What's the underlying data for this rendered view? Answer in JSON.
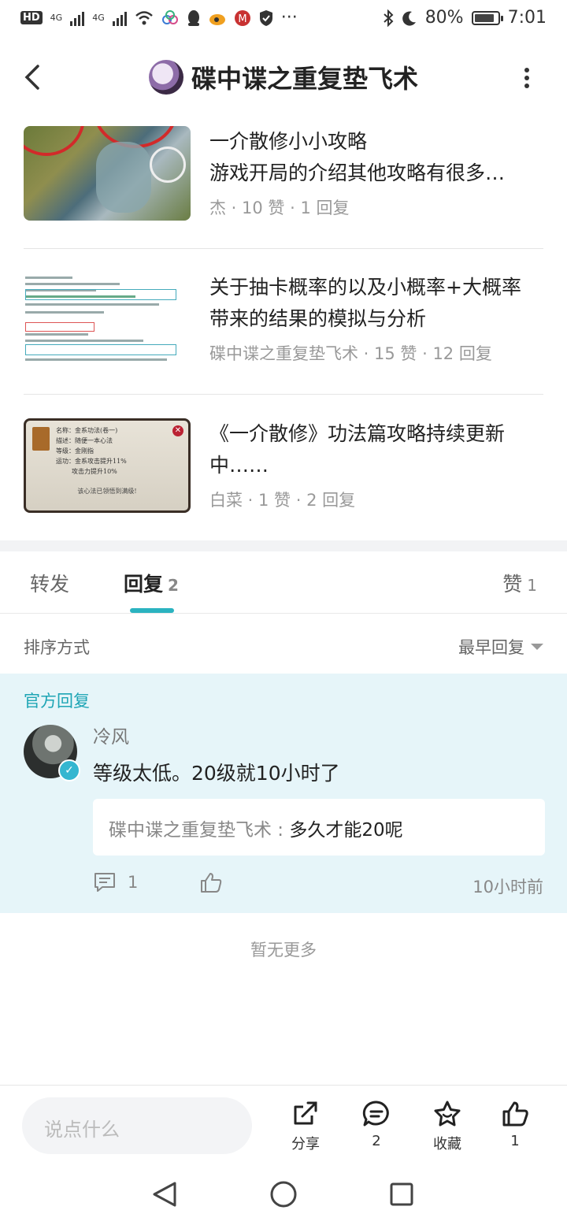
{
  "status_bar": {
    "hd": "HD",
    "sig1": "4G",
    "sig2": "4G",
    "more": "···",
    "battery": "80%",
    "time": "7:01"
  },
  "header": {
    "title": "碟中谍之重复垫飞术"
  },
  "articles": [
    {
      "title_lines": [
        "一介散修小小攻略",
        "游戏开局的介绍其他攻略有很多…"
      ],
      "meta": "杰 · 10 赞 · 1 回复"
    },
    {
      "title_lines": [
        "关于抽卡概率的以及小概率+大概率",
        "带来的结果的模拟与分析"
      ],
      "meta": "碟中谍之重复垫飞术 · 15 赞 · 12 回复"
    },
    {
      "title_lines": [
        "《一介散修》功法篇攻略持续更新",
        "中……"
      ],
      "meta": "白菜 · 1 赞 · 2 回复"
    }
  ],
  "tabs": [
    {
      "label": "转发",
      "count": ""
    },
    {
      "label": "回复",
      "count": "2"
    },
    {
      "label": "赞",
      "count": "1"
    }
  ],
  "sort": {
    "label": "排序方式",
    "value": "最早回复"
  },
  "reply": {
    "official_label": "官方回复",
    "user": "冷风",
    "text": "等级太低。20级就10小时了",
    "quote_user": "碟中谍之重复垫飞术",
    "quote_sep": " : ",
    "quote_text": "多久才能20呢",
    "comment_count": "1",
    "time": "10小时前"
  },
  "no_more": "暂无更多",
  "bottom": {
    "input_placeholder": "说点什么",
    "share_label": "分享",
    "comment_count": "2",
    "favorite_label": "收藏",
    "like_count": "1"
  },
  "thumb3_text": {
    "line1": "名称：金系功法(卷一)",
    "line2": "描述：随便一本心法",
    "line3": "等级：金刚指",
    "line4": "运功：金系攻击提升11%",
    "line5": "攻击力提升10%",
    "line6": "该心法已领悟到满级!"
  }
}
